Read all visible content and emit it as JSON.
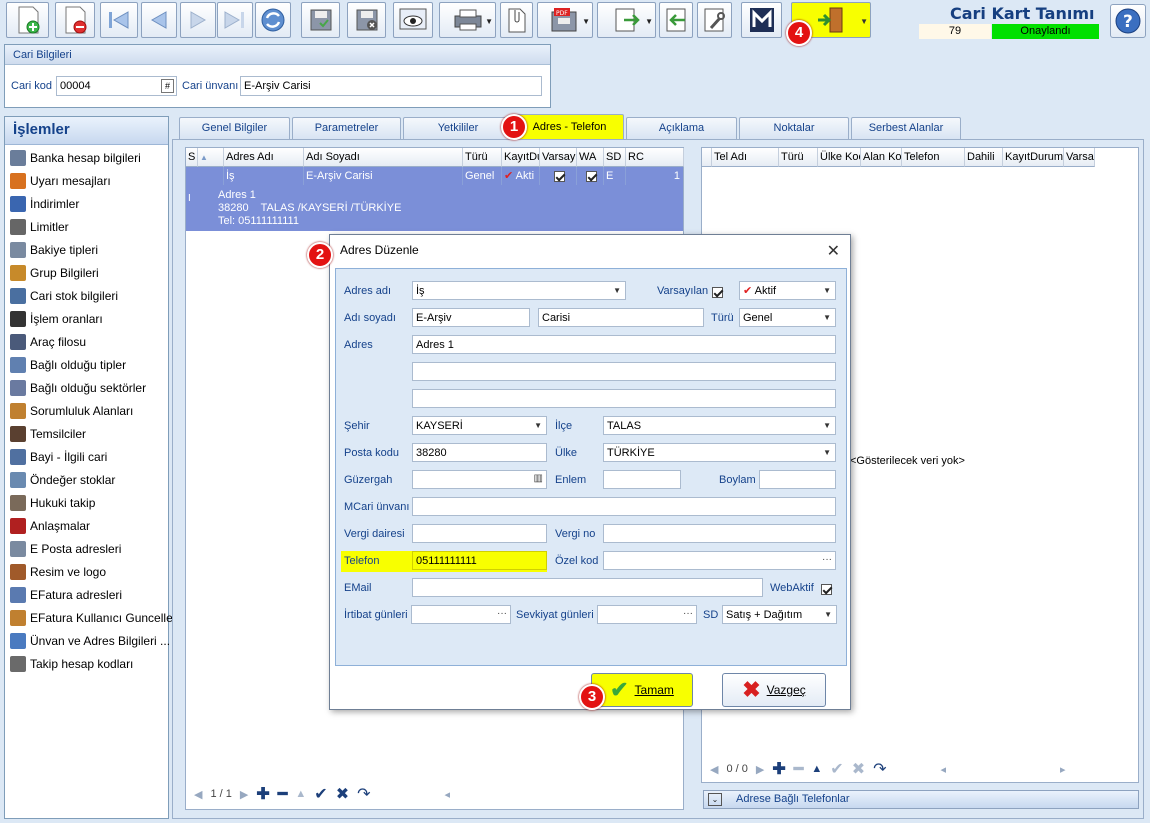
{
  "window": {
    "title": "Cari Kart Tanımı",
    "record_no": "79",
    "status": "Onaylandı"
  },
  "toolbar": {
    "buttons": [
      "add-record",
      "delete-record",
      "first-record",
      "previous-record",
      "next-record",
      "last-record",
      "refresh",
      "save",
      "cancel-save",
      "preview",
      "print",
      "attach",
      "pdf-export",
      "export",
      "import",
      "settings",
      "logo-m",
      "exit"
    ]
  },
  "cari_bilgileri": {
    "header": "Cari Bilgileri",
    "kod_label": "Cari kod",
    "kod_value": "00004",
    "unvan_label": "Cari ünvanı",
    "unvan_value": "E-Arşiv Carisi"
  },
  "sidebar": {
    "title": "İşlemler",
    "items": [
      {
        "label": "Banka hesap bilgileri",
        "icon": "bank-icon"
      },
      {
        "label": "Uyarı mesajları",
        "icon": "warning-icon"
      },
      {
        "label": "İndirimler",
        "icon": "discount-icon"
      },
      {
        "label": "Limitler",
        "icon": "limit-icon"
      },
      {
        "label": "Bakiye tipleri",
        "icon": "balance-icon"
      },
      {
        "label": "Grup Bilgileri",
        "icon": "group-icon"
      },
      {
        "label": "Cari stok bilgileri",
        "icon": "stock-icon"
      },
      {
        "label": "İşlem oranları",
        "icon": "percent-icon"
      },
      {
        "label": "Araç filosu",
        "icon": "fleet-icon"
      },
      {
        "label": "Bağlı olduğu tipler",
        "icon": "types-icon"
      },
      {
        "label": "Bağlı olduğu sektörler",
        "icon": "sectors-icon"
      },
      {
        "label": "Sorumluluk Alanları",
        "icon": "responsibility-icon"
      },
      {
        "label": "Temsilciler",
        "icon": "representative-icon"
      },
      {
        "label": "Bayi - İlgili cari",
        "icon": "dealer-icon"
      },
      {
        "label": "Öndeğer stoklar",
        "icon": "default-stock-icon"
      },
      {
        "label": "Hukuki takip",
        "icon": "legal-icon"
      },
      {
        "label": "Anlaşmalar",
        "icon": "agreement-icon"
      },
      {
        "label": "E Posta adresleri",
        "icon": "email-icon"
      },
      {
        "label": "Resim ve logo",
        "icon": "image-icon"
      },
      {
        "label": "EFatura adresleri",
        "icon": "einvoice-icon"
      },
      {
        "label": "EFatura Kullanıcı Guncelle",
        "icon": "einvoice-user-icon"
      },
      {
        "label": "Ünvan ve Adres Bilgileri ...",
        "icon": "address-icon"
      },
      {
        "label": "Takip hesap kodları",
        "icon": "tracking-icon"
      }
    ]
  },
  "tabs": [
    {
      "label": "Genel Bilgiler"
    },
    {
      "label": "Parametreler"
    },
    {
      "label": "Yetkililer"
    },
    {
      "label": "Adres - Telefon"
    },
    {
      "label": "Açıklama"
    },
    {
      "label": "Noktalar"
    },
    {
      "label": "Serbest Alanlar"
    }
  ],
  "address_grid": {
    "columns": [
      "S",
      "Adres Adı",
      "Adı Soyadı",
      "Türü",
      "KayıtDu",
      "Varsay",
      "WA",
      "SD",
      "RC"
    ],
    "row": {
      "adres_adi": "İş",
      "adi_soyadi": "E-Arşiv Carisi",
      "turu": "Genel",
      "kayit": "Akti",
      "sd": "E",
      "rc": "1"
    },
    "detail": [
      "Adres 1",
      "38280    TALAS /KAYSERİ /TÜRKİYE",
      "Tel: 05111111111"
    ],
    "nav": "1 / 1"
  },
  "phone_grid": {
    "columns": [
      "Tel Adı",
      "Türü",
      "Ülke Koc",
      "Alan Ko",
      "Telefon",
      "Dahili",
      "KayıtDurumu",
      "Varsa"
    ],
    "empty": "<Gösterilecek veri yok>",
    "nav": "0 / 0",
    "footer": "Adrese Bağlı Telefonlar"
  },
  "dialog": {
    "title": "Adres Düzenle",
    "fields": {
      "adres_adi_label": "Adres adı",
      "adres_adi": "İş",
      "varsayilan_label": "Varsayılan",
      "status": "Aktif",
      "adi_soyadi_label": "Adı soyadı",
      "adi": "E-Arşiv",
      "soyadi": "Carisi",
      "turu_label": "Türü",
      "turu": "Genel",
      "adres_label": "Adres",
      "adres1": "Adres 1",
      "adres2": "",
      "adres3": "",
      "sehir_label": "Şehir",
      "sehir": "KAYSERİ",
      "ilce_label": "İlçe",
      "ilce": "TALAS",
      "posta_label": "Posta kodu",
      "posta": "38280",
      "ulke_label": "Ülke",
      "ulke": "TÜRKİYE",
      "guzergah_label": "Güzergah",
      "enlem_label": "Enlem",
      "boylam_label": "Boylam",
      "mcari_label": "MCari ünvanı",
      "vergi_dairesi_label": "Vergi dairesi",
      "vergi_no_label": "Vergi no",
      "telefon_label": "Telefon",
      "telefon": "05111111111",
      "ozel_kod_label": "Özel kod",
      "email_label": "EMail",
      "webaktif_label": "WebAktif",
      "irtibat_label": "İrtibat günleri",
      "sevkiyat_label": "Sevkiyat günleri",
      "sd_label": "SD",
      "sd": "Satış + Dağıtım"
    },
    "ok_label": "Tamam",
    "cancel_label": "Vazgeç"
  },
  "badges": [
    "1",
    "2",
    "3",
    "4"
  ],
  "colors": {
    "highlight": "#f8ff00",
    "status_green": "#00e000",
    "badge": "#e31212",
    "selection": "#7b8fd8"
  }
}
